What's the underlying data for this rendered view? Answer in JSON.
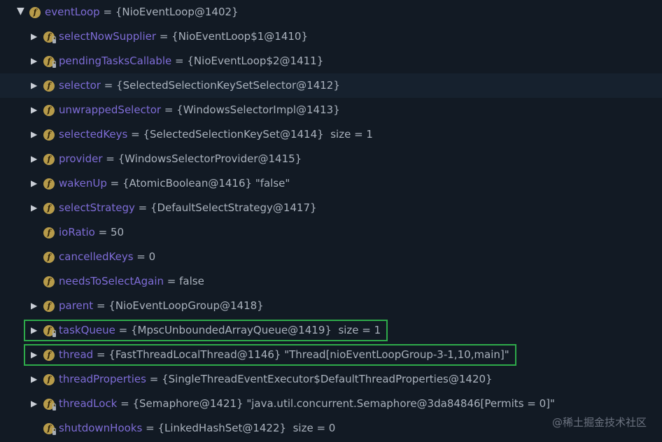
{
  "tree": {
    "rows": [
      {
        "name": "eventLoop",
        "value": "{NioEventLoop@1402}",
        "extra": "",
        "expanded": true,
        "expandable": true,
        "depth": 0,
        "locked": false
      },
      {
        "name": "selectNowSupplier",
        "value": "{NioEventLoop$1@1410}",
        "extra": "",
        "expanded": false,
        "expandable": true,
        "depth": 1,
        "locked": true
      },
      {
        "name": "pendingTasksCallable",
        "value": "{NioEventLoop$2@1411}",
        "extra": "",
        "expanded": false,
        "expandable": true,
        "depth": 1,
        "locked": true
      },
      {
        "name": "selector",
        "value": "{SelectedSelectionKeySetSelector@1412}",
        "extra": "",
        "expanded": false,
        "expandable": true,
        "depth": 1,
        "locked": false,
        "selected": true
      },
      {
        "name": "unwrappedSelector",
        "value": "{WindowsSelectorImpl@1413}",
        "extra": "",
        "expanded": false,
        "expandable": true,
        "depth": 1,
        "locked": false
      },
      {
        "name": "selectedKeys",
        "value": "{SelectedSelectionKeySet@1414}",
        "extra": "size = 1",
        "expanded": false,
        "expandable": true,
        "depth": 1,
        "locked": false
      },
      {
        "name": "provider",
        "value": "{WindowsSelectorProvider@1415}",
        "extra": "",
        "expanded": false,
        "expandable": true,
        "depth": 1,
        "locked": false
      },
      {
        "name": "wakenUp",
        "value": "{AtomicBoolean@1416} \"false\"",
        "extra": "",
        "expanded": false,
        "expandable": true,
        "depth": 1,
        "locked": false
      },
      {
        "name": "selectStrategy",
        "value": "{DefaultSelectStrategy@1417}",
        "extra": "",
        "expanded": false,
        "expandable": true,
        "depth": 1,
        "locked": false
      },
      {
        "name": "ioRatio",
        "value": "50",
        "extra": "",
        "expanded": false,
        "expandable": false,
        "depth": 1,
        "locked": false
      },
      {
        "name": "cancelledKeys",
        "value": "0",
        "extra": "",
        "expanded": false,
        "expandable": false,
        "depth": 1,
        "locked": false
      },
      {
        "name": "needsToSelectAgain",
        "value": "false",
        "extra": "",
        "expanded": false,
        "expandable": false,
        "depth": 1,
        "locked": false
      },
      {
        "name": "parent",
        "value": "{NioEventLoopGroup@1418}",
        "extra": "",
        "expanded": false,
        "expandable": true,
        "depth": 1,
        "locked": false
      },
      {
        "name": "taskQueue",
        "value": "{MpscUnboundedArrayQueue@1419}",
        "extra": "size = 1",
        "expanded": false,
        "expandable": true,
        "depth": 1,
        "locked": true,
        "highlighted": true
      },
      {
        "name": "thread",
        "value": "{FastThreadLocalThread@1146} \"Thread[nioEventLoopGroup-3-1,10,main]\"",
        "extra": "",
        "expanded": false,
        "expandable": true,
        "depth": 1,
        "locked": false,
        "highlighted": true
      },
      {
        "name": "threadProperties",
        "value": "{SingleThreadEventExecutor$DefaultThreadProperties@1420}",
        "extra": "",
        "expanded": false,
        "expandable": true,
        "depth": 1,
        "locked": false
      },
      {
        "name": "threadLock",
        "value": "{Semaphore@1421} \"java.util.concurrent.Semaphore@3da84846[Permits = 0]\"",
        "extra": "",
        "expanded": false,
        "expandable": true,
        "depth": 1,
        "locked": true
      },
      {
        "name": "shutdownHooks",
        "value": "{LinkedHashSet@1422}",
        "extra": "size = 0",
        "expanded": false,
        "expandable": false,
        "depth": 1,
        "locked": true
      }
    ]
  },
  "field_icon_glyph": "f",
  "eq_sign": "=",
  "watermark": "@稀土掘金技术社区",
  "colors": {
    "background": "#121a24",
    "selected_row": "#16212e",
    "field_name": "#7e6cd6",
    "value_text": "#aab2bd",
    "field_icon": "#b79b4a",
    "highlight_border": "#2eaa4a"
  }
}
